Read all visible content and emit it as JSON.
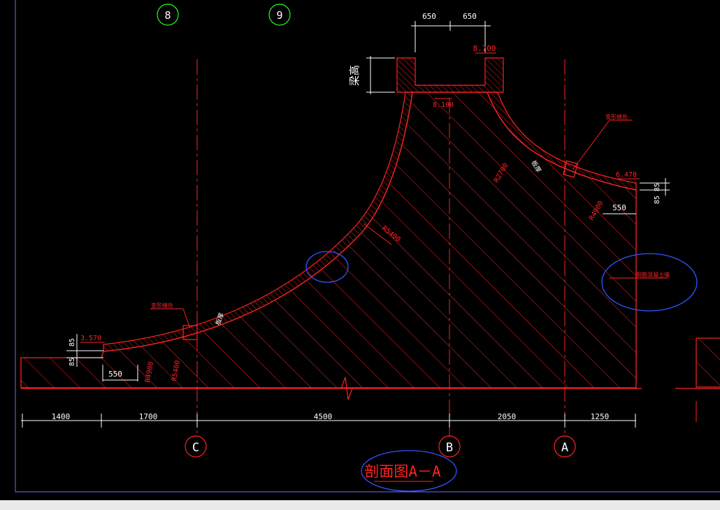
{
  "grid_top": {
    "left": "8",
    "right": "9"
  },
  "grid_bottom": {
    "c": "C",
    "b": "B",
    "a": "A"
  },
  "dims_top": {
    "left": "650",
    "right": "650"
  },
  "dims_bottom": [
    "1400",
    "1700",
    "4500",
    "2050",
    "1250"
  ],
  "elevations": {
    "top": "8.700",
    "right": "6.470",
    "left": "3.570"
  },
  "labels": {
    "bottom_slab": "8.100",
    "vertical_note": "梁高",
    "note_right": "变形缝处",
    "note_left": "变形缝处",
    "wall_note": "钢筋混凝土墙",
    "thickness_a": "板厚",
    "thickness_b": "板厚",
    "small_85_a": "85",
    "small_85_b": "85",
    "small_85_right": "85",
    "small_85_right_b": "85",
    "dim_550_left": "550",
    "dim_550_right": "550",
    "r2700": "R2700",
    "r4900_right": "R4900",
    "r5400_mid": "R5400",
    "r4900_left": "R4900",
    "r5400_left": "R5400",
    "title": "剖面图A－A"
  },
  "colors": {
    "red": "#ff2222",
    "green": "#22ff22",
    "blue": "#3355ff",
    "white": "#ffffff",
    "border": "#6b6bff"
  }
}
